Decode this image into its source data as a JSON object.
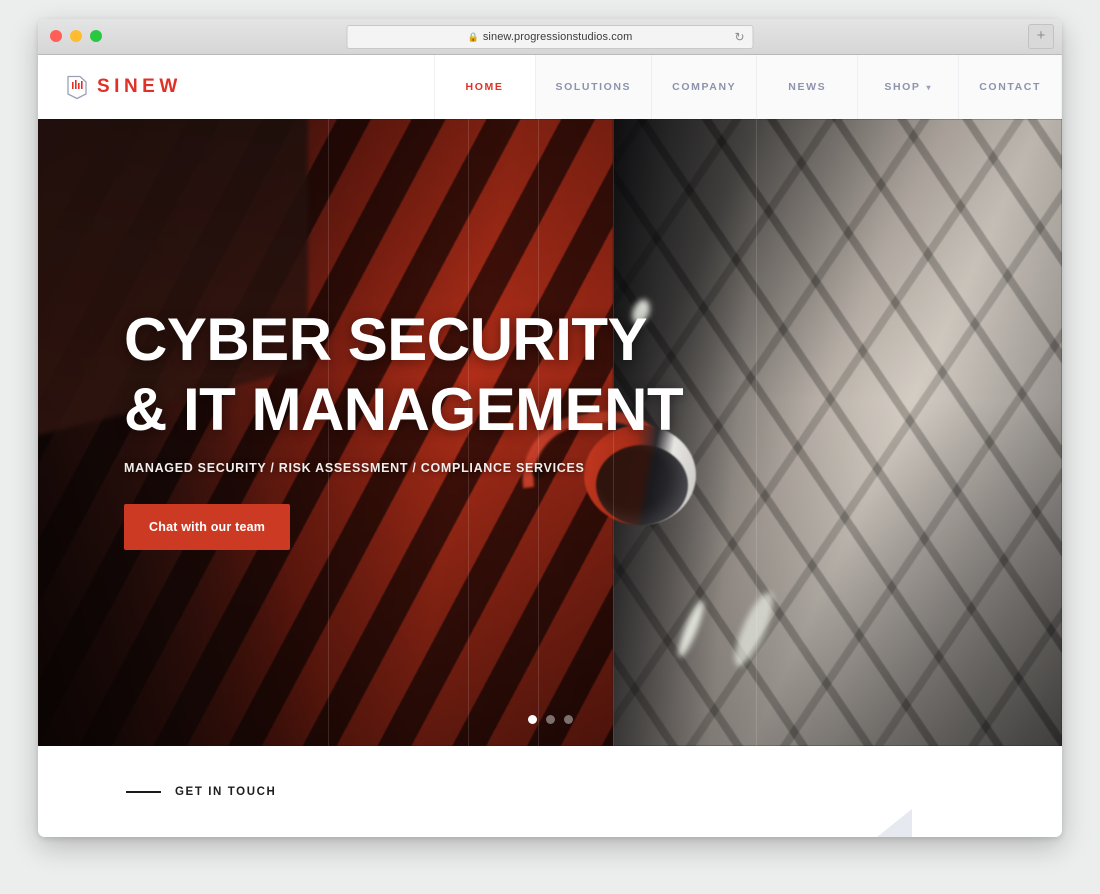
{
  "browser": {
    "url": "sinew.progressionstudios.com",
    "lock_icon": "lock-icon",
    "reload_icon": "reload-icon",
    "newtab_label": "+",
    "traffic_lights": [
      "close",
      "minimize",
      "zoom"
    ]
  },
  "site": {
    "logo_text": "SINEW",
    "logo_icon": "document-shield-icon",
    "accent_color": "#e03127",
    "button_color": "#cd3a24",
    "nav": [
      {
        "label": "HOME",
        "active": true,
        "has_dropdown": false
      },
      {
        "label": "SOLUTIONS",
        "active": false,
        "has_dropdown": false
      },
      {
        "label": "COMPANY",
        "active": false,
        "has_dropdown": false
      },
      {
        "label": "NEWS",
        "active": false,
        "has_dropdown": false
      },
      {
        "label": "SHOP",
        "active": false,
        "has_dropdown": true
      },
      {
        "label": "CONTACT",
        "active": false,
        "has_dropdown": false
      }
    ]
  },
  "hero": {
    "title_line1": "CYBER SECURITY",
    "title_line2": "& IT MANAGEMENT",
    "subtitle": "MANAGED SECURITY / RISK ASSESSMENT / COMPLIANCE SERVICES",
    "cta_label": "Chat with our team",
    "slides": {
      "total": 3,
      "active": 1
    }
  },
  "contact_section": {
    "eyebrow_text": "GET IN TOUCH"
  }
}
